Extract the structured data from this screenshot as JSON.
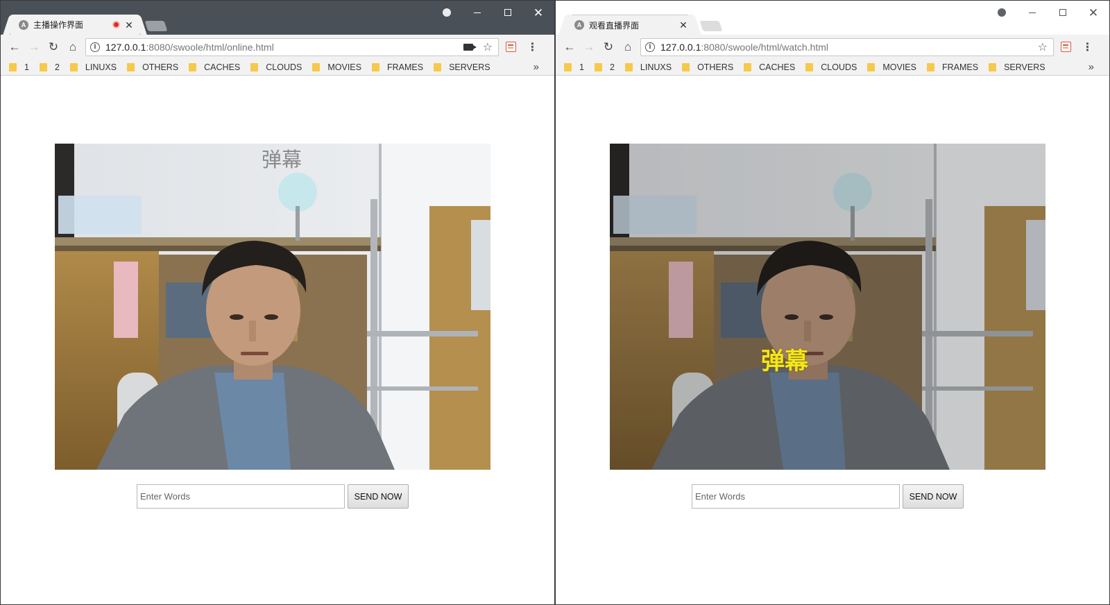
{
  "left_window": {
    "tab_title": "主播操作界面",
    "url_host": "127.0.0.1",
    "url_rest": ":8080/swoole/html/online.html",
    "danmaku_text": "弹幕",
    "danmaku_color": "#7a7a7a"
  },
  "right_window": {
    "tab_title": "观看直播界面",
    "url_host": "127.0.0.1",
    "url_rest": ":8080/swoole/html/watch.html",
    "danmaku_text": "弹幕",
    "danmaku_color": "#f5e51a"
  },
  "favicon_letter": "A",
  "bookmarks": [
    "1",
    "2",
    "LINUXS",
    "OTHERS",
    "CACHES",
    "CLOUDS",
    "MOVIES",
    "FRAMES",
    "SERVERS"
  ],
  "form": {
    "placeholder": "Enter Words",
    "send_label": "SEND NOW"
  },
  "icons": {
    "back": "back-arrow-icon",
    "forward": "forward-arrow-icon",
    "reload": "reload-icon",
    "home": "home-icon",
    "info": "info-icon",
    "camera": "camera-icon",
    "star": "bookmark-star-icon",
    "menu": "kebab-menu-icon"
  }
}
